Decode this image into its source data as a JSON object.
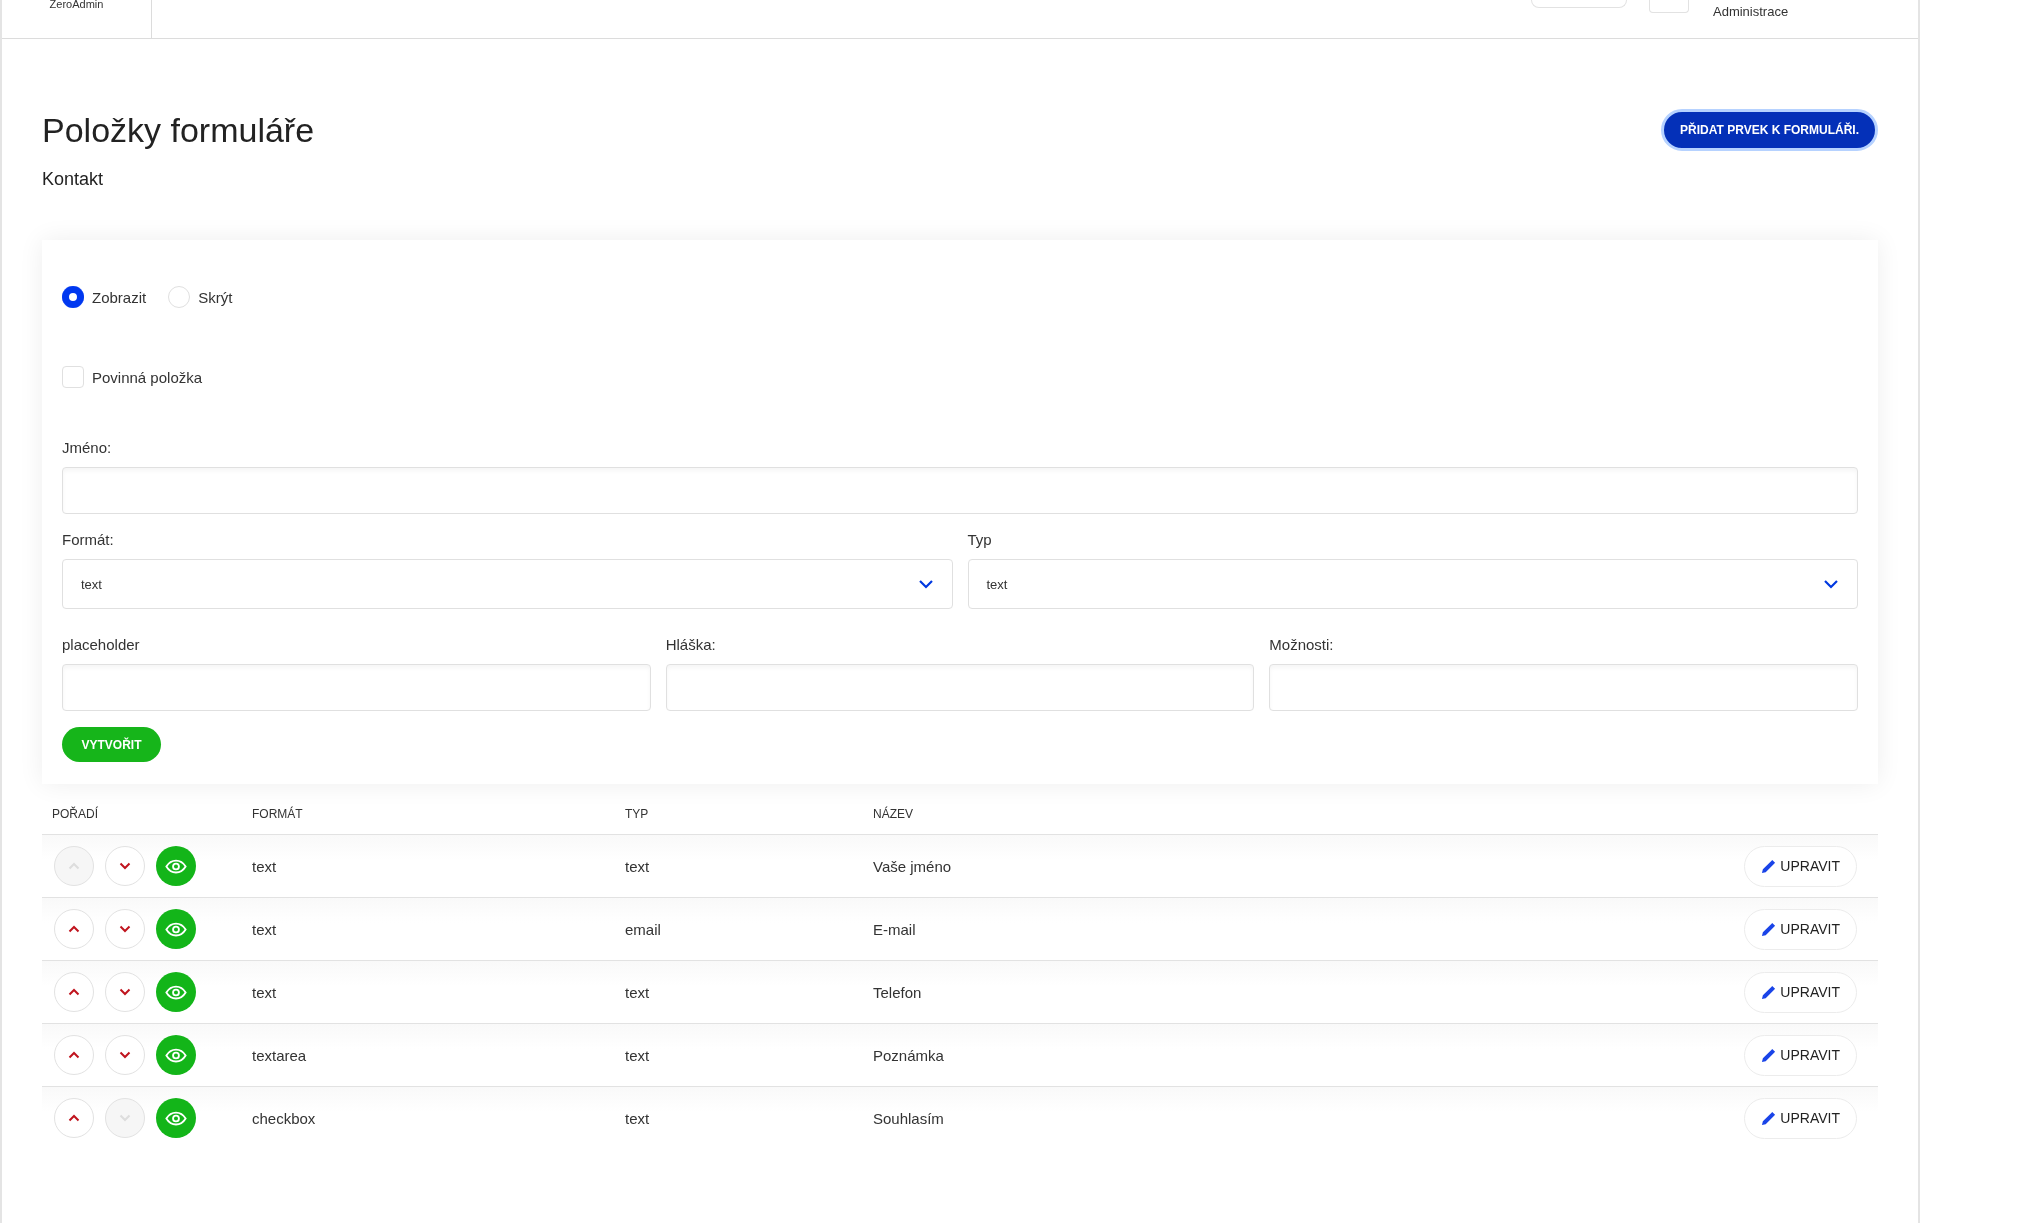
{
  "header": {
    "logo_text": "ZeroAdmin",
    "user_label": "Administrace"
  },
  "page": {
    "title": "Položky formuláře",
    "subtitle": "Kontakt",
    "add_button": "PŘIDAT PRVEK K FORMULÁŘI."
  },
  "form": {
    "visibility": [
      {
        "label": "Zobrazit",
        "selected": true
      },
      {
        "label": "Skrýt",
        "selected": false
      }
    ],
    "required": {
      "label": "Povinná položka",
      "checked": false
    },
    "name_label": "Jméno:",
    "format": {
      "label": "Formát:",
      "value": "text"
    },
    "type": {
      "label": "Typ",
      "value": "text"
    },
    "text_fields": [
      {
        "label": "placeholder"
      },
      {
        "label": "Hláška:"
      },
      {
        "label": "Možnosti:"
      }
    ],
    "submit": "VYTVOŘIT"
  },
  "table": {
    "columns": [
      "POŘADÍ",
      "FORMÁT",
      "TYP",
      "NÁZEV"
    ],
    "rows": [
      {
        "format": "text",
        "type": "text",
        "name": "Vaše jméno",
        "up_disabled": true,
        "down_disabled": false,
        "visible": true,
        "action": "UPRAVIT"
      },
      {
        "format": "text",
        "type": "email",
        "name": "E-mail",
        "up_disabled": false,
        "down_disabled": false,
        "visible": true,
        "action": "UPRAVIT"
      },
      {
        "format": "text",
        "type": "text",
        "name": "Telefon",
        "up_disabled": false,
        "down_disabled": false,
        "visible": true,
        "action": "UPRAVIT"
      },
      {
        "format": "textarea",
        "type": "text",
        "name": "Poznámka",
        "up_disabled": false,
        "down_disabled": false,
        "visible": true,
        "action": "UPRAVIT"
      },
      {
        "format": "checkbox",
        "type": "text",
        "name": "Souhlasím",
        "up_disabled": false,
        "down_disabled": true,
        "visible": true,
        "action": "UPRAVIT"
      }
    ]
  }
}
